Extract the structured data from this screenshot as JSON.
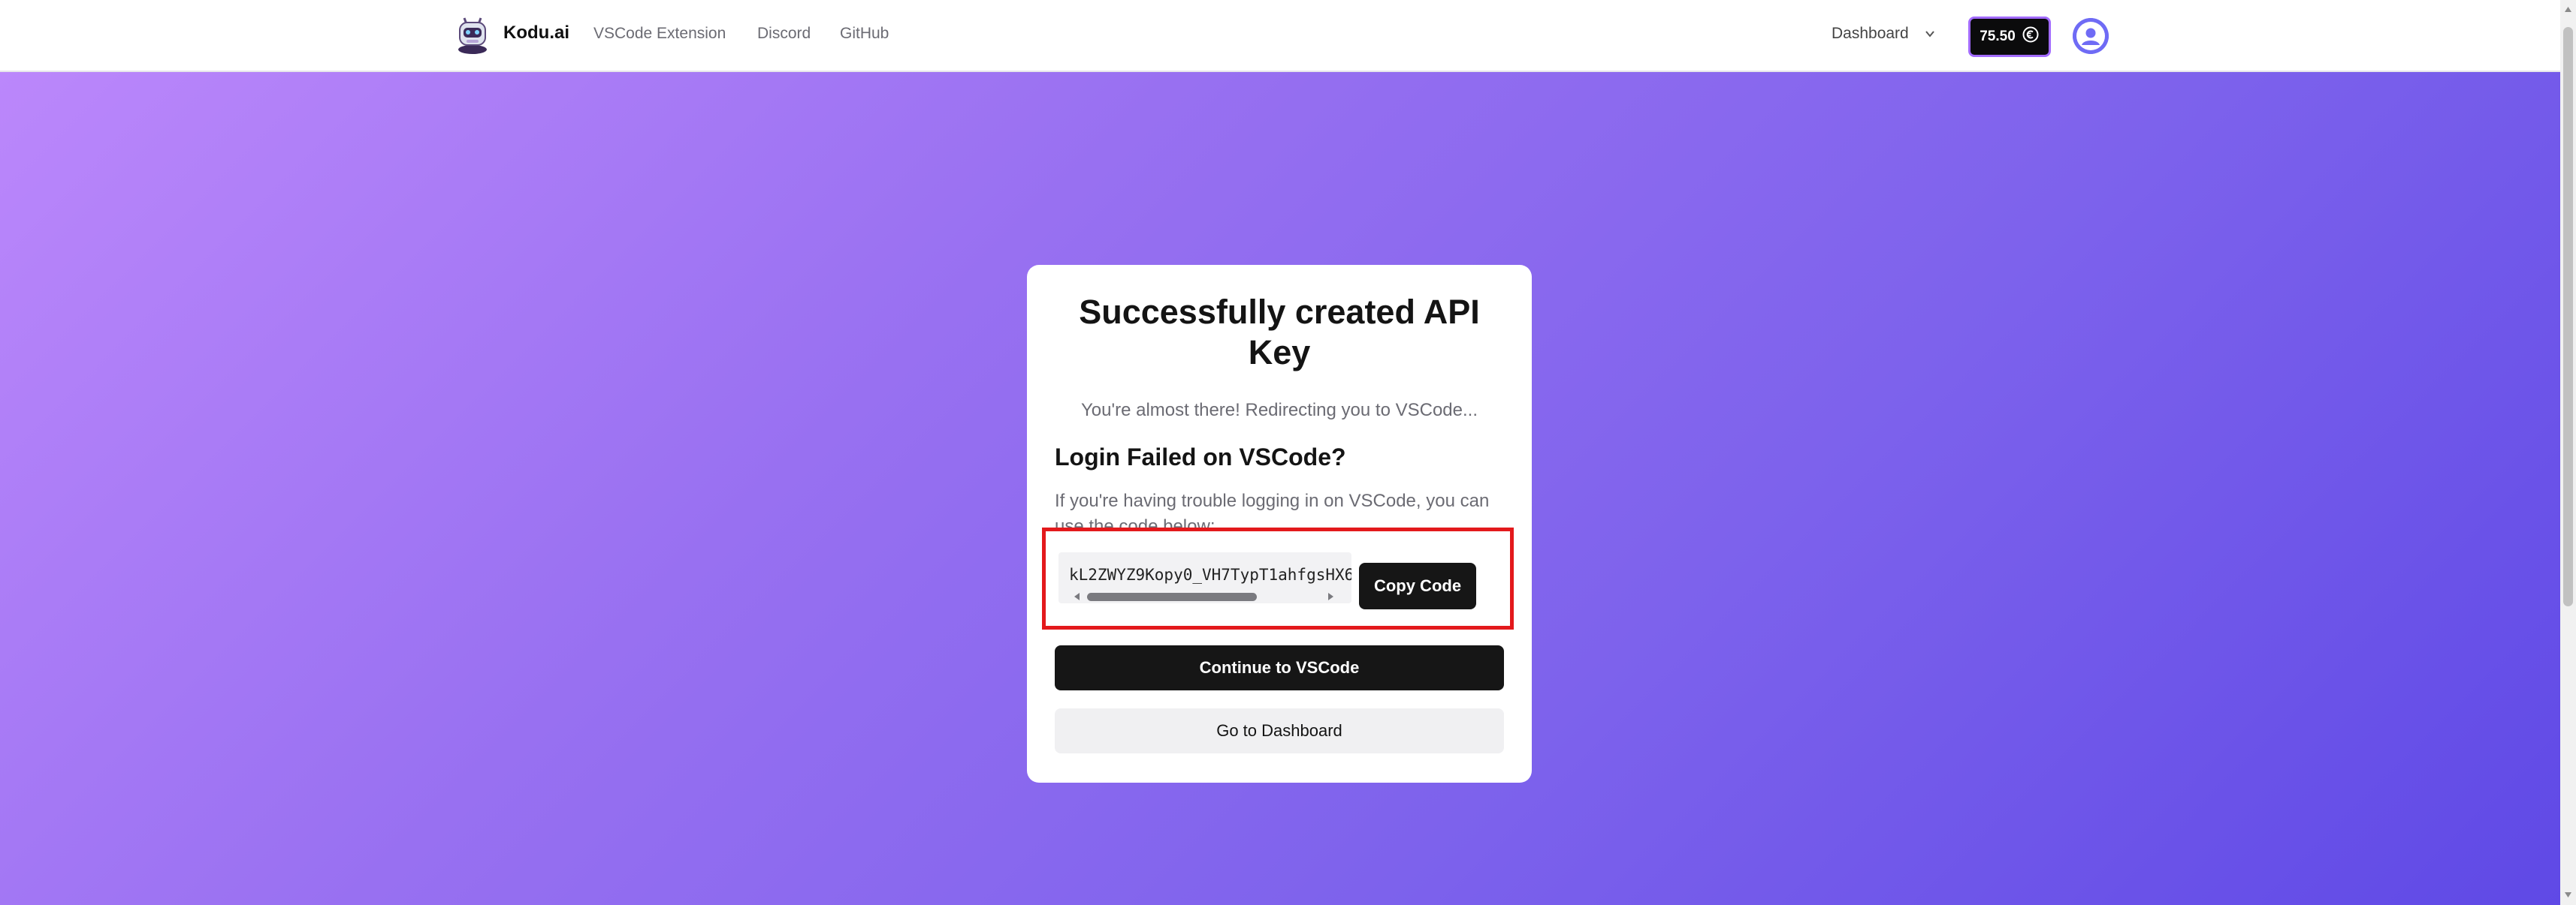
{
  "nav": {
    "brand": "Kodu.ai",
    "links": [
      "VSCode Extension",
      "Discord",
      "GitHub"
    ],
    "dashboard_label": "Dashboard",
    "credits": "75.50",
    "logo_icon": "robot-logo-icon",
    "avatar_icon": "user-avatar-icon"
  },
  "card": {
    "title": "Successfully created API Key",
    "subtitle": "You're almost there! Redirecting you to VSCode...",
    "heading": "Login Failed on VSCode?",
    "help_text": "If you're having trouble logging in on VSCode, you can use the code below:",
    "code": "kL2ZWYZ9Kopy0_VH7TypT1ahfgsHX6",
    "copy_label": "Copy Code",
    "continue_label": "Continue to VSCode",
    "dashboard_label": "Go to Dashboard"
  },
  "colors": {
    "gradient_start": "#bb87fb",
    "gradient_end": "#5f49e6",
    "highlight": "#e3191c",
    "credits_border": "#a26bff"
  }
}
